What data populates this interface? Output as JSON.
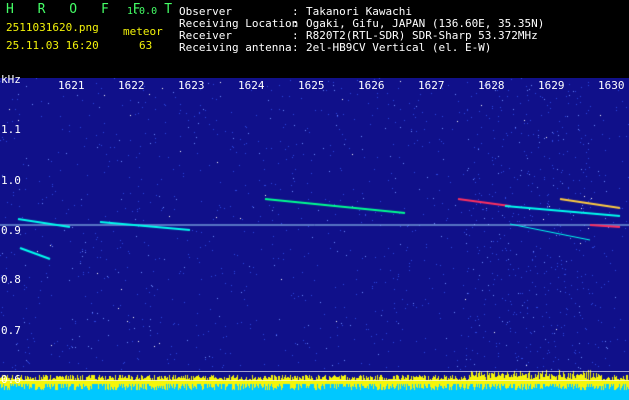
{
  "app": {
    "name": "H R O F F T",
    "version": "1.0.0",
    "mode_label": "meteor"
  },
  "file": {
    "name": "2511031620.png",
    "datetime": "25.11.03 16:20",
    "count": "63"
  },
  "info": [
    {
      "label": "Observer",
      "sep": ":",
      "value": "Takanori Kawachi"
    },
    {
      "label": "Receiving Location",
      "sep": ":",
      "value": "Ogaki, Gifu, JAPAN (136.60E, 35.35N)"
    },
    {
      "label": "Receiver",
      "sep": ":",
      "value": "R820T2(RTL-SDR) SDR-Sharp 53.372MHz"
    },
    {
      "label": "Receiving antenna",
      "sep": ":",
      "value": "2el-HB9CV Vertical (el. E-W)"
    }
  ],
  "spectrogram": {
    "unit": "kHz",
    "x_ticks": [
      "1621",
      "1622",
      "1623",
      "1624",
      "1625",
      "1626",
      "1627",
      "1628",
      "1629",
      "1630"
    ],
    "y_ticks": [
      "1.1",
      "1.0",
      "0.9",
      "0.8",
      "0.7",
      "0.6"
    ],
    "colors": {
      "background": "#10108a",
      "noise": "#3a5cff",
      "signal": "#00ffee",
      "strong": "#ff3060",
      "bar": "#f5f50a",
      "footer": "#00c8ff"
    }
  }
}
